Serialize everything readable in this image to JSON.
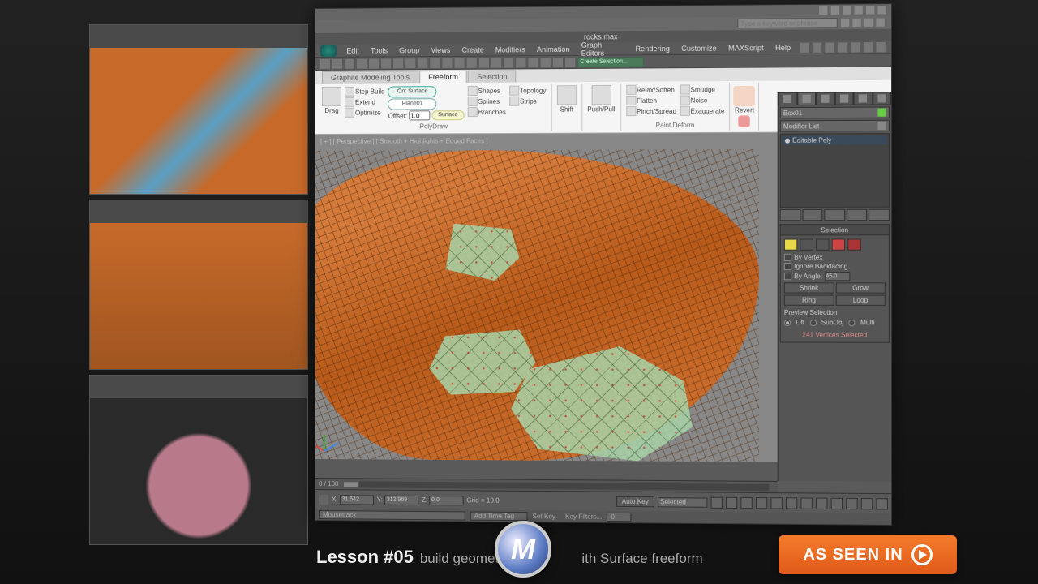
{
  "caption": {
    "lesson": "Lesson #05",
    "desc_pre": "build geometry",
    "desc_post": "ith Surface freeform"
  },
  "badge": {
    "text": "AS SEEN IN"
  },
  "logo": {
    "letter": "M"
  },
  "titlebar": {
    "search_placeholder": "Type a keyword or phrase"
  },
  "doc": {
    "title": "rocks.max"
  },
  "menu": {
    "items": [
      "Edit",
      "Tools",
      "Group",
      "Views",
      "Create",
      "Modifiers",
      "Animation",
      "Graph Editors",
      "Rendering",
      "Customize",
      "MAXScript",
      "Help"
    ]
  },
  "toolbar": {
    "selection_set": "Create Selection..."
  },
  "ribbon": {
    "tabs": [
      "Graphite Modeling Tools",
      "Freeform",
      "Selection"
    ],
    "active_tab": "Freeform",
    "polydraw": {
      "label": "PolyDraw",
      "drag": "Drag",
      "step_build": "Step Build",
      "extend": "Extend",
      "optimize": "Optimize",
      "on_surface": "On: Surface",
      "plane": "Plane01",
      "offset_label": "Offset:",
      "offset_value": "1.0",
      "surface_btn": "Surface",
      "shapes": "Shapes",
      "splines": "Splines",
      "branches": "Branches",
      "topology": "Topology",
      "strips": "Strips"
    },
    "shift": {
      "label": "Shift"
    },
    "pushpull": {
      "label": "Push/Pull"
    },
    "paintdeform": {
      "label": "Paint Deform",
      "relax": "Relax/Soften",
      "flatten": "Flatten",
      "pinch": "Pinch/Spread",
      "smudge": "Smudge",
      "noise": "Noise",
      "exaggerate": "Exaggerate"
    },
    "revert": {
      "label": "Revert"
    }
  },
  "viewport": {
    "label": "[ + ] [ Perspective ] [ Smooth + Highlights + Edged Faces ]"
  },
  "cmdpanel": {
    "obj_name": "Box01",
    "modlist_label": "Modifier List",
    "stack_item": "Editable Poly",
    "selection": {
      "header": "Selection",
      "by_vertex": "By Vertex",
      "ignore_backfacing": "Ignore Backfacing",
      "by_angle": "By Angle:",
      "angle_value": "45.0",
      "shrink": "Shrink",
      "grow": "Grow",
      "ring": "Ring",
      "loop": "Loop",
      "preview": "Preview Selection",
      "off": "Off",
      "subobj": "SubObj",
      "multi": "Multi",
      "count": "241 Vertices Selected"
    }
  },
  "timeline": {
    "range": "0 / 100"
  },
  "status": {
    "x_label": "X:",
    "x": "31.542",
    "y_label": "Y:",
    "y": "312.969",
    "z_label": "Z:",
    "z": "0.0",
    "grid": "Grid = 10.0",
    "autokey": "Auto Key",
    "setkey": "Set Key",
    "selected": "Selected",
    "keyfilters": "Key Filters...",
    "mousetrack": "Mousetrack",
    "add_time_tag": "Add Time Tag",
    "mn_value": "0"
  }
}
